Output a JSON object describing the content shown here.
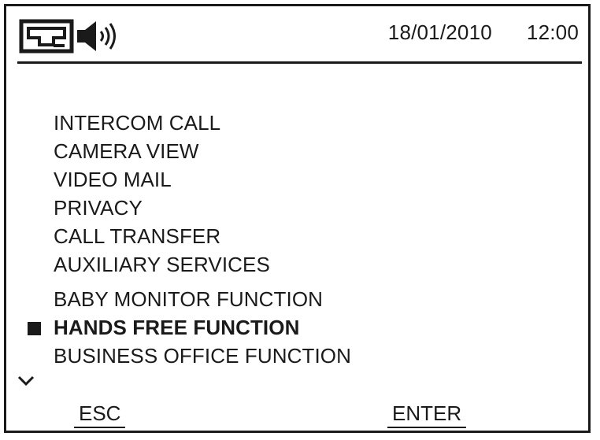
{
  "header": {
    "status_icons": [
      "intercom-icon",
      "speaker-volume-icon"
    ],
    "date": "18/01/2010",
    "time": "12:00"
  },
  "menu": {
    "items": [
      {
        "label": "INTERCOM CALL",
        "selected": false
      },
      {
        "label": "CAMERA VIEW",
        "selected": false
      },
      {
        "label": "VIDEO MAIL",
        "selected": false
      },
      {
        "label": "PRIVACY",
        "selected": false
      },
      {
        "label": "CALL TRANSFER",
        "selected": false
      },
      {
        "label": "AUXILIARY SERVICES",
        "selected": false
      },
      {
        "label": "BABY MONITOR FUNCTION",
        "selected": false
      },
      {
        "label": "HANDS FREE FUNCTION",
        "selected": true
      },
      {
        "label": "BUSINESS OFFICE FUNCTION",
        "selected": false
      }
    ],
    "scroll_indicator": "chevron-down-icon"
  },
  "softkeys": {
    "left_label": "ESC",
    "right_label": "ENTER"
  }
}
